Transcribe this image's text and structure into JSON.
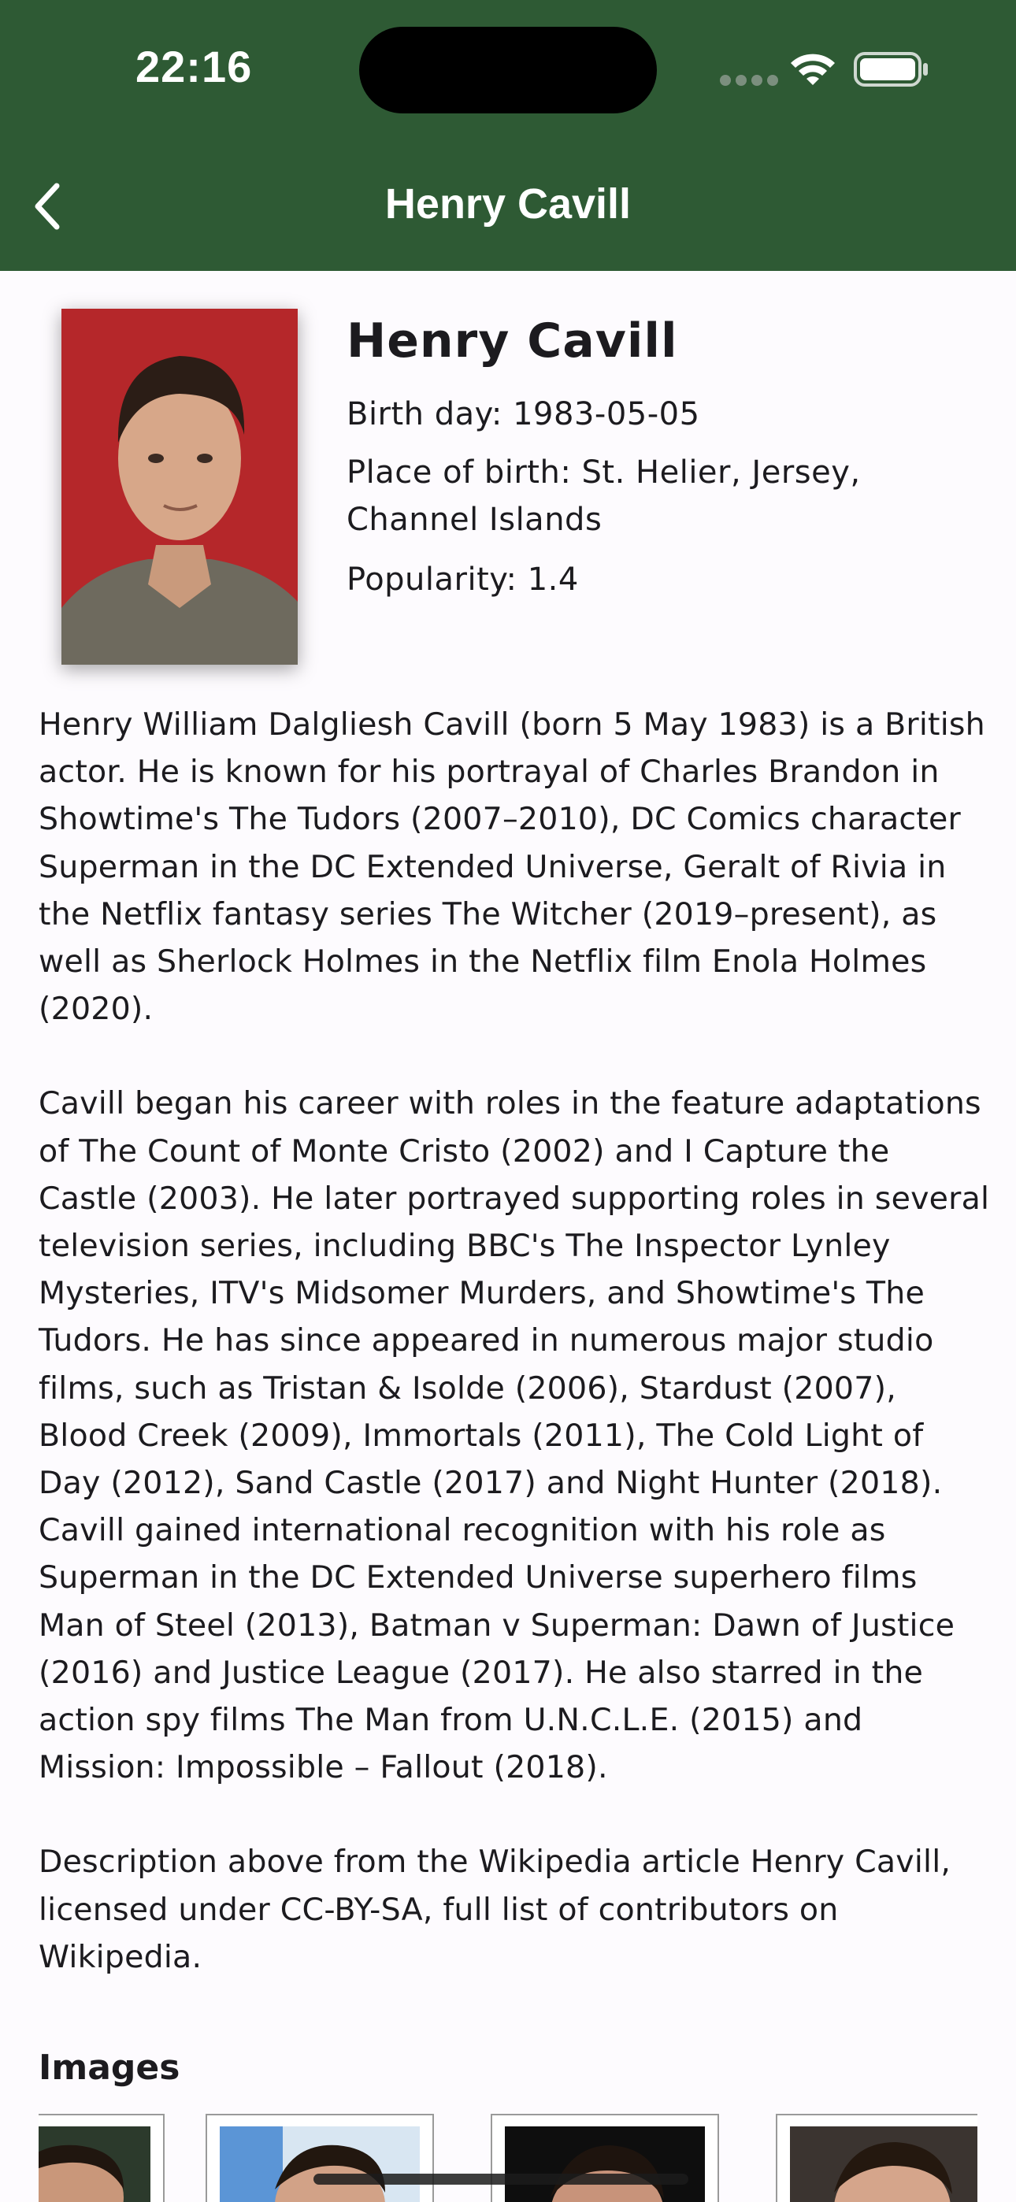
{
  "status_bar": {
    "time": "22:16"
  },
  "app_bar": {
    "title": "Henry Cavill",
    "back_icon": "chevron-left-icon"
  },
  "person": {
    "name": "Henry Cavill",
    "birthday": "Birth day: 1983-05-05",
    "place_of_birth": "Place of birth: St. Helier, Jersey, Channel Islands",
    "popularity": "Popularity: 1.4"
  },
  "bio": {
    "p1": "Henry William Dalgliesh Cavill (born 5 May 1983) is a British actor. He is known for his portrayal of Charles Brandon in Showtime's The Tudors (2007–2010), DC Comics character Superman in the DC Extended Universe, Geralt of Rivia in the Netflix fantasy series The Witcher (2019–present), as well as Sherlock Holmes in the Netflix film Enola Holmes (2020).",
    "p2": "Cavill began his career with roles in the feature adaptations of The Count of Monte Cristo (2002) and I Capture the Castle (2003). He later portrayed supporting roles in several television series, including BBC's The Inspector Lynley Mysteries, ITV's Midsomer Murders, and Showtime's The Tudors. He has since appeared in numerous major studio films, such as Tristan & Isolde (2006), Stardust (2007), Blood Creek (2009), Immortals (2011), The Cold Light of Day (2012), Sand Castle (2017) and Night Hunter (2018). Cavill gained international recognition with his role as Superman in the DC Extended Universe superhero films Man of Steel (2013), Batman v Superman: Dawn of Justice (2016) and Justice League (2017). He also starred in the action spy films The Man from U.N.C.L.E. (2015) and Mission: Impossible – Fallout (2018).",
    "p3": "Description above from the Wikipedia article Henry Cavill, licensed under CC-BY-SA, full list of contributors on Wikipedia."
  },
  "images_section": {
    "title": "Images"
  },
  "colors": {
    "app_bar": "#2e5a34",
    "background": "#fdfbfe",
    "photo_bg": "#b5272a"
  }
}
